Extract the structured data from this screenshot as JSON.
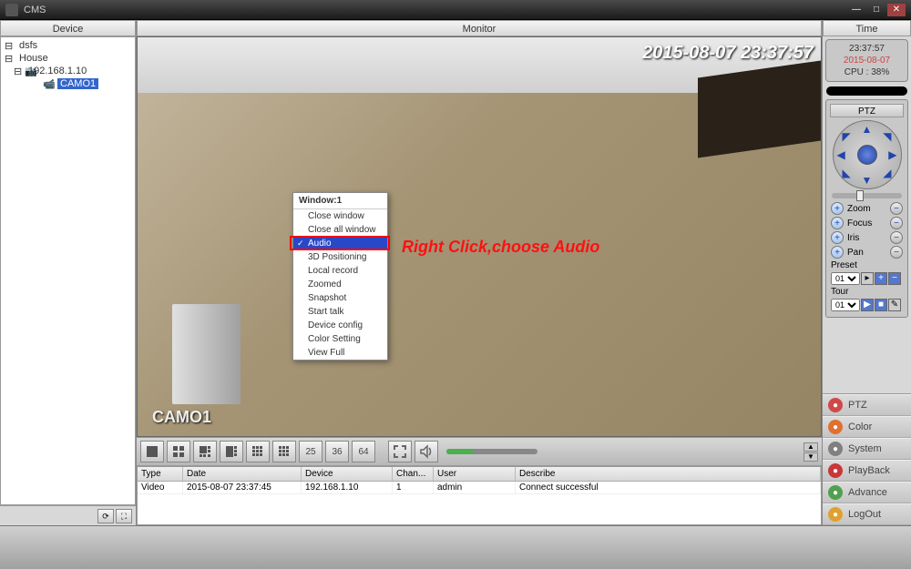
{
  "app": {
    "title": "CMS"
  },
  "headers": {
    "device": "Device",
    "monitor": "Monitor",
    "time": "Time"
  },
  "tree": {
    "root1": "dsfs",
    "root2": "House",
    "ip": "192.168.1.10",
    "cam": "CAMO1"
  },
  "video": {
    "timestamp": "2015-08-07 23:37:57",
    "label": "CAMO1"
  },
  "context": {
    "title": "Window:1",
    "items": [
      "Close window",
      "Close all window",
      "Audio",
      "3D Positioning",
      "Local record",
      "Zoomed",
      "Snapshot",
      "Start talk",
      "Device config",
      "Color Setting",
      "View Full"
    ],
    "activeIndex": 2
  },
  "annotation": "Right Click,choose Audio",
  "toolbar": {
    "layouts": [
      "1",
      "4",
      "6",
      "8",
      "9",
      "16",
      "25",
      "36",
      "64"
    ]
  },
  "log": {
    "cols": {
      "type": "Type",
      "date": "Date",
      "device": "Device",
      "chan": "Chan...",
      "user": "User",
      "desc": "Describe"
    },
    "rows": [
      {
        "type": "Video",
        "date": "2015-08-07 23:37:45",
        "device": "192.168.1.10",
        "chan": "1",
        "user": "admin",
        "desc": "Connect successful"
      }
    ]
  },
  "timebox": {
    "time": "23:37:57",
    "date": "2015-08-07",
    "cpu": "CPU : 38%"
  },
  "ptz": {
    "title": "PTZ",
    "controls": [
      "Zoom",
      "Focus",
      "Iris",
      "Pan"
    ],
    "preset": "Preset",
    "presetVal": "01",
    "tour": "Tour",
    "tourVal": "01"
  },
  "menu": {
    "items": [
      {
        "label": "PTZ",
        "color": "#d04848"
      },
      {
        "label": "Color",
        "color": "#e07030"
      },
      {
        "label": "System",
        "color": "#808080"
      },
      {
        "label": "PlayBack",
        "color": "#c83838"
      },
      {
        "label": "Advance",
        "color": "#50a050"
      },
      {
        "label": "LogOut",
        "color": "#e0a030"
      }
    ]
  }
}
